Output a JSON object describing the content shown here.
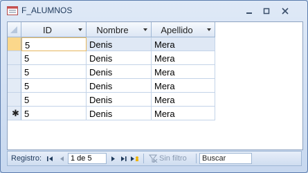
{
  "window": {
    "title": "F_ALUMNOS"
  },
  "columns": [
    {
      "label": "ID"
    },
    {
      "label": "Nombre"
    },
    {
      "label": "Apellido"
    }
  ],
  "rows": [
    {
      "id": "5",
      "nombre": "Denis",
      "apellido": "Mera"
    },
    {
      "id": "5",
      "nombre": "Denis",
      "apellido": "Mera"
    },
    {
      "id": "5",
      "nombre": "Denis",
      "apellido": "Mera"
    },
    {
      "id": "5",
      "nombre": "Denis",
      "apellido": "Mera"
    },
    {
      "id": "5",
      "nombre": "Denis",
      "apellido": "Mera"
    },
    {
      "id": "5",
      "nombre": "Denis",
      "apellido": "Mera"
    }
  ],
  "new_row_marker": "✱",
  "nav": {
    "label": "Registro:",
    "record": "1 de 5",
    "filter_label": "Sin filtro",
    "search_label": "Buscar"
  },
  "colors": {
    "current_row": "#fbd78b",
    "accent": "#1e395b"
  }
}
